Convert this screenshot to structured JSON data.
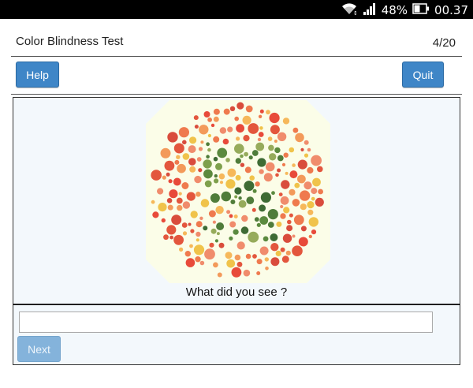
{
  "status_bar": {
    "icons": [
      "wifi-icon",
      "signal-icon",
      "battery-icon"
    ],
    "battery": "48%",
    "time": "00.37"
  },
  "header": {
    "title": "Color Blindness Test",
    "progress": "4/20"
  },
  "toolbar": {
    "help_label": "Help",
    "quit_label": "Quit"
  },
  "test": {
    "question": "What did you see ?",
    "answer_value": "",
    "next_label": "Next"
  },
  "colors": {
    "accent": "#3f86c7",
    "accent_disabled": "#84b3db",
    "panel_bg": "#f3f8fc",
    "plate_background": [
      "#e3563d",
      "#ef7a4e",
      "#f39a5a",
      "#f6b85a",
      "#f0c34a",
      "#e84a3a",
      "#f08c6c",
      "#d94c3c"
    ],
    "plate_figure": [
      "#3e6b34",
      "#5b8a3e",
      "#7ea04c",
      "#4f7c3a",
      "#96ab5b"
    ]
  }
}
